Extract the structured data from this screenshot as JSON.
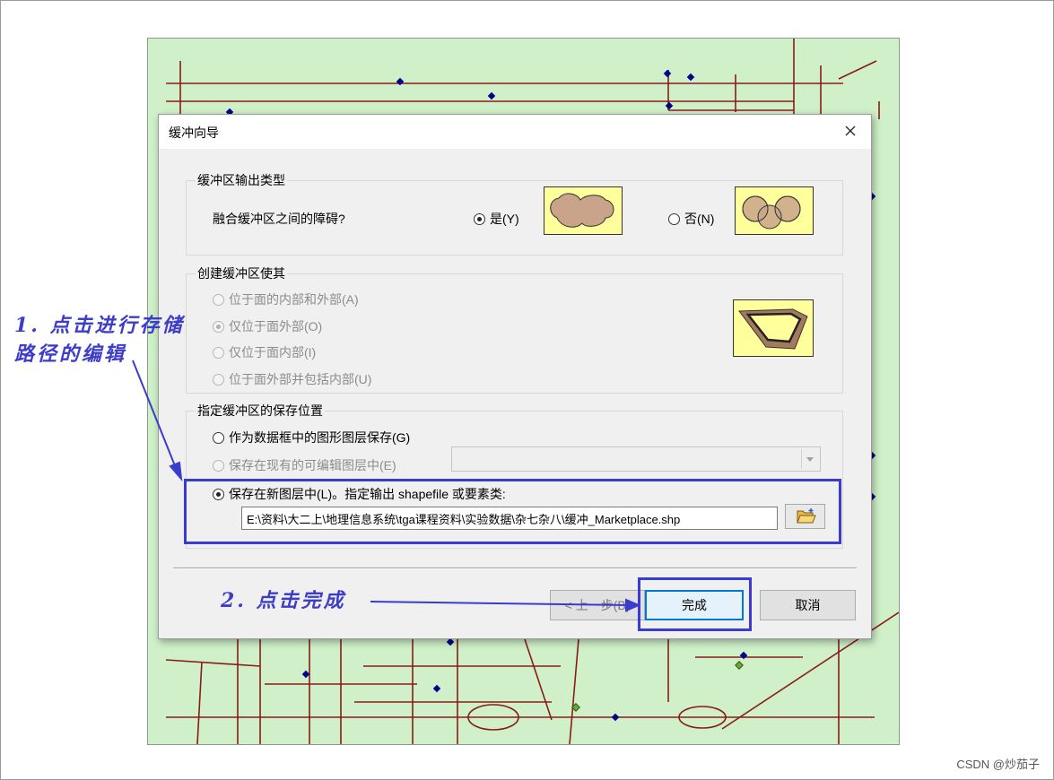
{
  "dialog": {
    "title": "缓冲向导",
    "section_output_type": {
      "label": "缓冲区输出类型",
      "question": "融合缓冲区之间的障碍?",
      "options": [
        {
          "label": "是(Y)",
          "selected": true
        },
        {
          "label": "否(N)",
          "selected": false
        }
      ]
    },
    "section_create": {
      "label": "创建缓冲区使其",
      "options": [
        {
          "label": "位于面的内部和外部(A)",
          "selected": false
        },
        {
          "label": "仅位于面外部(O)",
          "selected": true
        },
        {
          "label": "仅位于面内部(I)",
          "selected": false
        },
        {
          "label": "位于面外部并包括内部(U)",
          "selected": false
        }
      ]
    },
    "section_save": {
      "label": "指定缓冲区的保存位置",
      "options": [
        {
          "label": "作为数据框中的图形图层保存(G)",
          "selected": false
        },
        {
          "label": "保存在现有的可编辑图层中(E)",
          "selected": false
        },
        {
          "label": "保存在新图层中(L)。指定输出 shapefile 或要素类:",
          "selected": true
        }
      ],
      "path": "E:\\资料\\大二上\\地理信息系统\\tga课程资料\\实验数据\\杂七杂八\\缓冲_Marketplace.shp"
    },
    "buttons": {
      "back": "< 上一步(B)",
      "finish": "完成",
      "cancel": "取消"
    }
  },
  "annotations": {
    "note1_line1": "1. 点击进行存储",
    "note1_line2": "路径的编辑",
    "note2": "2. 点击完成",
    "color": "#3a3ccf"
  },
  "watermark": "CSDN @炒茄子",
  "colors": {
    "map_bg": "#cff0c8",
    "road": "#8b1a1a",
    "point": "#00008b",
    "symbol_fill": "#ffff9c",
    "buffer_fill": "#c9a48a"
  }
}
